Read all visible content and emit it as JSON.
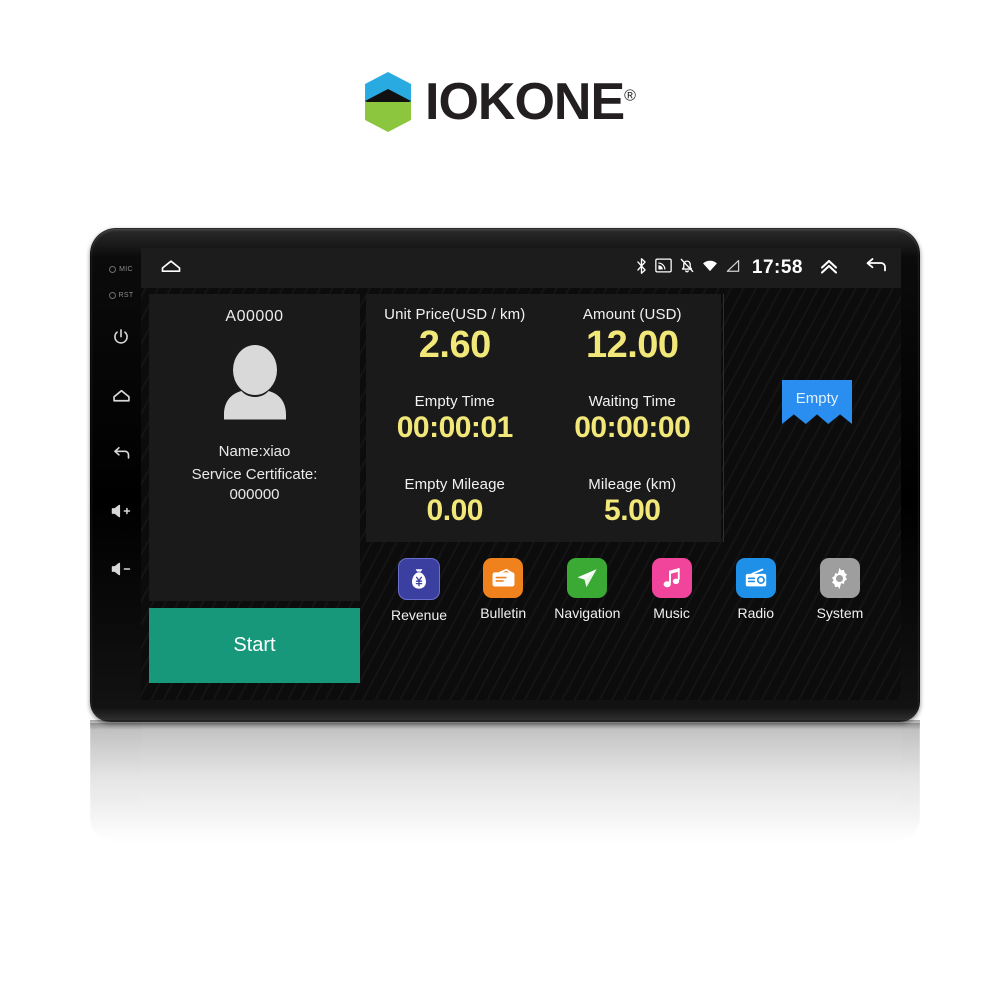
{
  "brand": {
    "name": "IOKONE",
    "registered": "®",
    "logo_colors": {
      "top": "#29ABE2",
      "middle": "#111111",
      "bottom": "#8CC63F"
    }
  },
  "device": {
    "bezel_buttons": [
      {
        "name": "mic",
        "label": "MIC"
      },
      {
        "name": "reset",
        "label": "RST"
      },
      {
        "name": "power",
        "label": ""
      },
      {
        "name": "home",
        "label": ""
      },
      {
        "name": "back",
        "label": ""
      },
      {
        "name": "volume-up",
        "label": ""
      },
      {
        "name": "volume-down",
        "label": ""
      }
    ]
  },
  "statusbar": {
    "home_icon": "home-icon",
    "icons": [
      "bluetooth-icon",
      "cast-icon",
      "bell-off-icon",
      "wifi-icon",
      "signal-icon"
    ],
    "clock": "17:58",
    "expand_icon": "chevron-double-up-icon",
    "back_icon": "back-arrow-icon"
  },
  "driver": {
    "plate": "A00000",
    "avatar": "user-avatar-icon",
    "name": "Name:xiao",
    "certificate_label": "Service  Certificate:",
    "certificate_value": "000000"
  },
  "start_button": {
    "label": "Start",
    "color": "#17987B"
  },
  "status_badge": {
    "label": "Empty",
    "color": "#2A8EF0"
  },
  "meters": [
    {
      "label": "Unit Price(USD / km)",
      "value": "2.60",
      "size": "large"
    },
    {
      "label": "Amount (USD)",
      "value": "12.00",
      "size": "large"
    },
    {
      "label": "Empty Time",
      "value": "00:00:01",
      "size": "time"
    },
    {
      "label": "Waiting Time",
      "value": "00:00:00",
      "size": "time"
    },
    {
      "label": "Empty Mileage",
      "value": "0.00",
      "size": "small"
    },
    {
      "label": "Mileage (km)",
      "value": "5.00",
      "size": "small"
    }
  ],
  "meter_value_color": "#F2E87A",
  "dock": [
    {
      "label": "Revenue",
      "icon": "money-bag-icon",
      "color": "#3A3FA0"
    },
    {
      "label": "Bulletin",
      "icon": "envelope-icon",
      "color": "#F0821E"
    },
    {
      "label": "Navigation",
      "icon": "paper-plane-icon",
      "color": "#3AAA35"
    },
    {
      "label": "Music",
      "icon": "music-note-icon",
      "color": "#F0459B"
    },
    {
      "label": "Radio",
      "icon": "radio-icon",
      "color": "#1E90E8"
    },
    {
      "label": "System",
      "icon": "gear-icon",
      "color": "#9E9E9E"
    }
  ]
}
